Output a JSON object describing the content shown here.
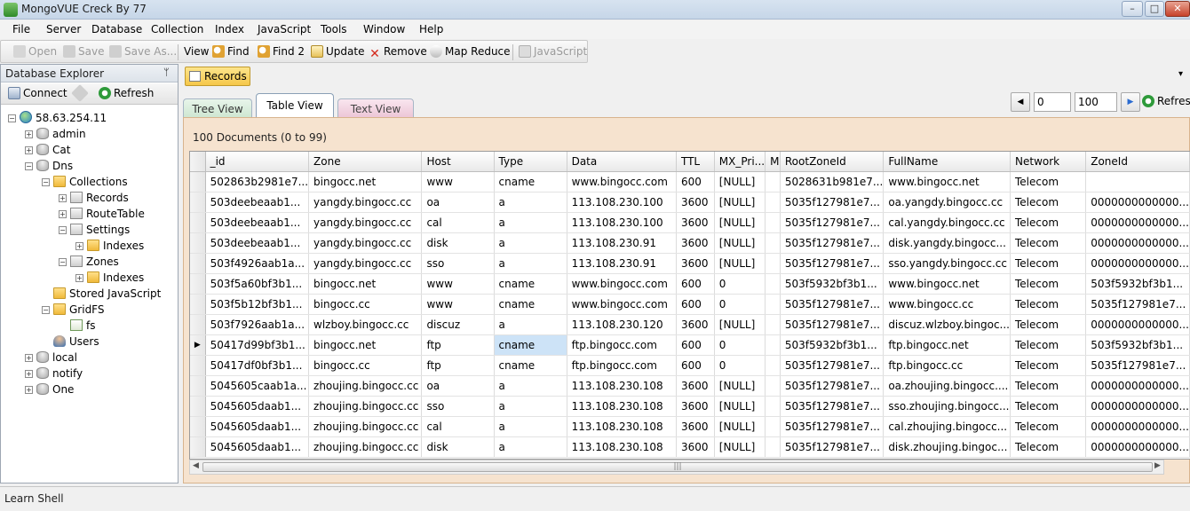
{
  "window": {
    "title": "MongoVUE Creck By 77",
    "min": "–",
    "max": "□",
    "close": "✕"
  },
  "menu": [
    "File",
    "Server",
    "Database",
    "Collection",
    "Index",
    "JavaScript",
    "Tools",
    "Window",
    "Help"
  ],
  "toolbar": {
    "open": "Open",
    "save": "Save",
    "save_as": "Save As...",
    "view": "View",
    "find": "Find",
    "find2": "Find 2",
    "update": "Update",
    "remove": "Remove",
    "map_reduce": "Map Reduce",
    "javascript": "JavaScript"
  },
  "explorer": {
    "title": "Database Explorer",
    "pin": "ᛘ",
    "connect": "Connect",
    "refresh": "Refresh"
  },
  "tree": [
    {
      "label": "58.63.254.11",
      "icon": "globe",
      "depth": 0,
      "exp": "−"
    },
    {
      "label": "admin",
      "icon": "db",
      "depth": 1,
      "exp": "+"
    },
    {
      "label": "Cat",
      "icon": "db",
      "depth": 1,
      "exp": "+"
    },
    {
      "label": "Dns",
      "icon": "db",
      "depth": 1,
      "exp": "−"
    },
    {
      "label": "Collections",
      "icon": "folder",
      "depth": 2,
      "exp": "−"
    },
    {
      "label": "Records",
      "icon": "coll",
      "depth": 3,
      "exp": "+"
    },
    {
      "label": "RouteTable",
      "icon": "coll",
      "depth": 3,
      "exp": "+"
    },
    {
      "label": "Settings",
      "icon": "coll",
      "depth": 3,
      "exp": "−"
    },
    {
      "label": "Indexes",
      "icon": "folder",
      "depth": 4,
      "exp": "+"
    },
    {
      "label": "Zones",
      "icon": "coll",
      "depth": 3,
      "exp": "−"
    },
    {
      "label": "Indexes",
      "icon": "folder",
      "depth": 4,
      "exp": "+"
    },
    {
      "label": "Stored JavaScript",
      "icon": "folder",
      "depth": 2,
      "exp": ""
    },
    {
      "label": "GridFS",
      "icon": "folder",
      "depth": 2,
      "exp": "−"
    },
    {
      "label": "fs",
      "icon": "file",
      "depth": 3,
      "exp": ""
    },
    {
      "label": "Users",
      "icon": "user",
      "depth": 2,
      "exp": ""
    },
    {
      "label": "local",
      "icon": "db",
      "depth": 1,
      "exp": "+"
    },
    {
      "label": "notify",
      "icon": "db",
      "depth": 1,
      "exp": "+"
    },
    {
      "label": "One",
      "icon": "db",
      "depth": 1,
      "exp": "+"
    }
  ],
  "records_button": "Records",
  "tabs": {
    "tree": "Tree View",
    "table": "Table View",
    "text": "Text View"
  },
  "pager": {
    "prev": "◀",
    "next": "▶",
    "skip": "0",
    "limit": "100",
    "refresh": "Refresh"
  },
  "grid": {
    "count": "100 Documents (0 to 99)",
    "columns": [
      "_id",
      "Zone",
      "Host",
      "Type",
      "Data",
      "TTL",
      "MX_Pri...",
      "M",
      "RootZoneId",
      "FullName",
      "Network",
      "ZoneId"
    ],
    "rows": [
      [
        "502863b2981e7...",
        "bingocc.net",
        "www",
        "cname",
        "www.bingocc.com",
        "600",
        "[NULL]",
        "",
        "5028631b981e7...",
        "www.bingocc.net",
        "Telecom",
        ""
      ],
      [
        "503deebeaab1...",
        "yangdy.bingocc.cc",
        "oa",
        "a",
        "113.108.230.100",
        "3600",
        "[NULL]",
        "",
        "5035f127981e7...",
        "oa.yangdy.bingocc.cc",
        "Telecom",
        "0000000000000..."
      ],
      [
        "503deebeaab1...",
        "yangdy.bingocc.cc",
        "cal",
        "a",
        "113.108.230.100",
        "3600",
        "[NULL]",
        "",
        "5035f127981e7...",
        "cal.yangdy.bingocc.cc",
        "Telecom",
        "0000000000000..."
      ],
      [
        "503deebeaab1...",
        "yangdy.bingocc.cc",
        "disk",
        "a",
        "113.108.230.91",
        "3600",
        "[NULL]",
        "",
        "5035f127981e7...",
        "disk.yangdy.bingocc...",
        "Telecom",
        "0000000000000..."
      ],
      [
        "503f4926aab1a...",
        "yangdy.bingocc.cc",
        "sso",
        "a",
        "113.108.230.91",
        "3600",
        "[NULL]",
        "",
        "5035f127981e7...",
        "sso.yangdy.bingocc.cc",
        "Telecom",
        "0000000000000..."
      ],
      [
        "503f5a60bf3b1...",
        "bingocc.net",
        "www",
        "cname",
        "www.bingocc.com",
        "600",
        "0",
        "",
        "503f5932bf3b1...",
        "www.bingocc.net",
        "Telecom",
        "503f5932bf3b1..."
      ],
      [
        "503f5b12bf3b1...",
        "bingocc.cc",
        "www",
        "cname",
        "www.bingocc.com",
        "600",
        "0",
        "",
        "5035f127981e7...",
        "www.bingocc.cc",
        "Telecom",
        "5035f127981e7..."
      ],
      [
        "503f7926aab1a...",
        "wlzboy.bingocc.cc",
        "discuz",
        "a",
        "113.108.230.120",
        "3600",
        "[NULL]",
        "",
        "5035f127981e7...",
        "discuz.wlzboy.bingoc...",
        "Telecom",
        "0000000000000..."
      ],
      [
        "50417d99bf3b1...",
        "bingocc.net",
        "ftp",
        "cname",
        "ftp.bingocc.com",
        "600",
        "0",
        "",
        "503f5932bf3b1...",
        "ftp.bingocc.net",
        "Telecom",
        "503f5932bf3b1..."
      ],
      [
        "50417df0bf3b1...",
        "bingocc.cc",
        "ftp",
        "cname",
        "ftp.bingocc.com",
        "600",
        "0",
        "",
        "5035f127981e7...",
        "ftp.bingocc.cc",
        "Telecom",
        "5035f127981e7..."
      ],
      [
        "5045605caab1a...",
        "zhoujing.bingocc.cc",
        "oa",
        "a",
        "113.108.230.108",
        "3600",
        "[NULL]",
        "",
        "5035f127981e7...",
        "oa.zhoujing.bingocc....",
        "Telecom",
        "0000000000000..."
      ],
      [
        "5045605daab1...",
        "zhoujing.bingocc.cc",
        "sso",
        "a",
        "113.108.230.108",
        "3600",
        "[NULL]",
        "",
        "5035f127981e7...",
        "sso.zhoujing.bingocc...",
        "Telecom",
        "0000000000000..."
      ],
      [
        "5045605daab1...",
        "zhoujing.bingocc.cc",
        "cal",
        "a",
        "113.108.230.108",
        "3600",
        "[NULL]",
        "",
        "5035f127981e7...",
        "cal.zhoujing.bingocc...",
        "Telecom",
        "0000000000000..."
      ],
      [
        "5045605daab1...",
        "zhoujing.bingocc.cc",
        "disk",
        "a",
        "113.108.230.108",
        "3600",
        "[NULL]",
        "",
        "5035f127981e7...",
        "disk.zhoujing.bingoc...",
        "Telecom",
        "0000000000000..."
      ]
    ],
    "current_row": 8,
    "current_marker": "▶",
    "selected_cell": [
      8,
      3
    ],
    "scroll_left": "◀",
    "scroll_right": "▶",
    "scroll_grip": "|||"
  },
  "learn_shell": "Learn Shell",
  "colors": {
    "accent": "#f5c749",
    "selection": "#cde3f7",
    "grid_panel": "#f6e3cf"
  }
}
